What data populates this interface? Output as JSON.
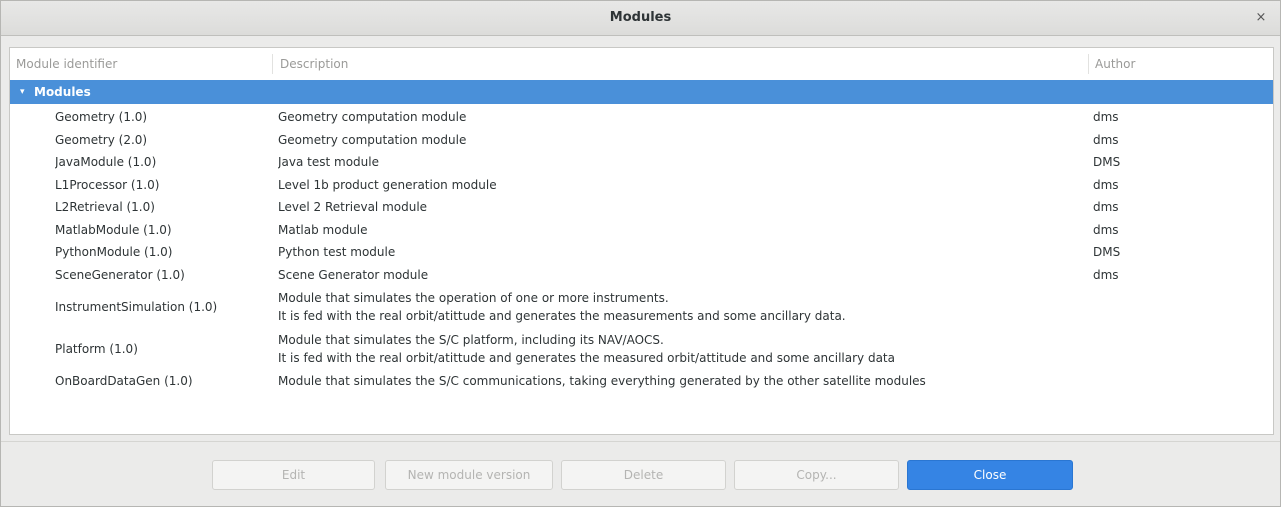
{
  "window": {
    "title": "Modules",
    "close_glyph": "×"
  },
  "table": {
    "columns": [
      "Module identifier",
      "Description",
      "Author"
    ],
    "group": {
      "label": "Modules",
      "expanded": true,
      "expander_glyph": "▾"
    },
    "rows": [
      {
        "id": "Geometry (1.0)",
        "desc": [
          "Geometry computation module"
        ],
        "author": "dms"
      },
      {
        "id": "Geometry (2.0)",
        "desc": [
          "Geometry computation module"
        ],
        "author": "dms"
      },
      {
        "id": "JavaModule (1.0)",
        "desc": [
          "Java test module"
        ],
        "author": "DMS"
      },
      {
        "id": "L1Processor (1.0)",
        "desc": [
          "Level 1b product generation module"
        ],
        "author": "dms"
      },
      {
        "id": "L2Retrieval (1.0)",
        "desc": [
          "Level 2 Retrieval module"
        ],
        "author": "dms"
      },
      {
        "id": "MatlabModule (1.0)",
        "desc": [
          "Matlab module"
        ],
        "author": "dms"
      },
      {
        "id": "PythonModule (1.0)",
        "desc": [
          "Python test module"
        ],
        "author": "DMS"
      },
      {
        "id": "SceneGenerator (1.0)",
        "desc": [
          "Scene Generator module"
        ],
        "author": "dms"
      },
      {
        "id": "InstrumentSimulation (1.0)",
        "desc": [
          "Module that simulates the operation of one or more instruments.",
          "It is fed with the real orbit/atittude and generates the measurements and some ancillary data."
        ],
        "author": ""
      },
      {
        "id": "Platform (1.0)",
        "desc": [
          "Module that simulates the S/C platform, including its NAV/AOCS.",
          "It is fed with the real orbit/atittude and generates the measured orbit/attitude and some ancillary data"
        ],
        "author": ""
      },
      {
        "id": "OnBoardDataGen (1.0)",
        "desc": [
          "Module that simulates the S/C communications, taking everything generated by the other satellite modules"
        ],
        "author": ""
      }
    ]
  },
  "buttons": {
    "edit": "Edit",
    "new_version": "New module version",
    "delete": "Delete",
    "copy": "Copy...",
    "close": "Close"
  },
  "colors": {
    "selection": "#4a90d9",
    "primary_button": "#3584e4"
  }
}
